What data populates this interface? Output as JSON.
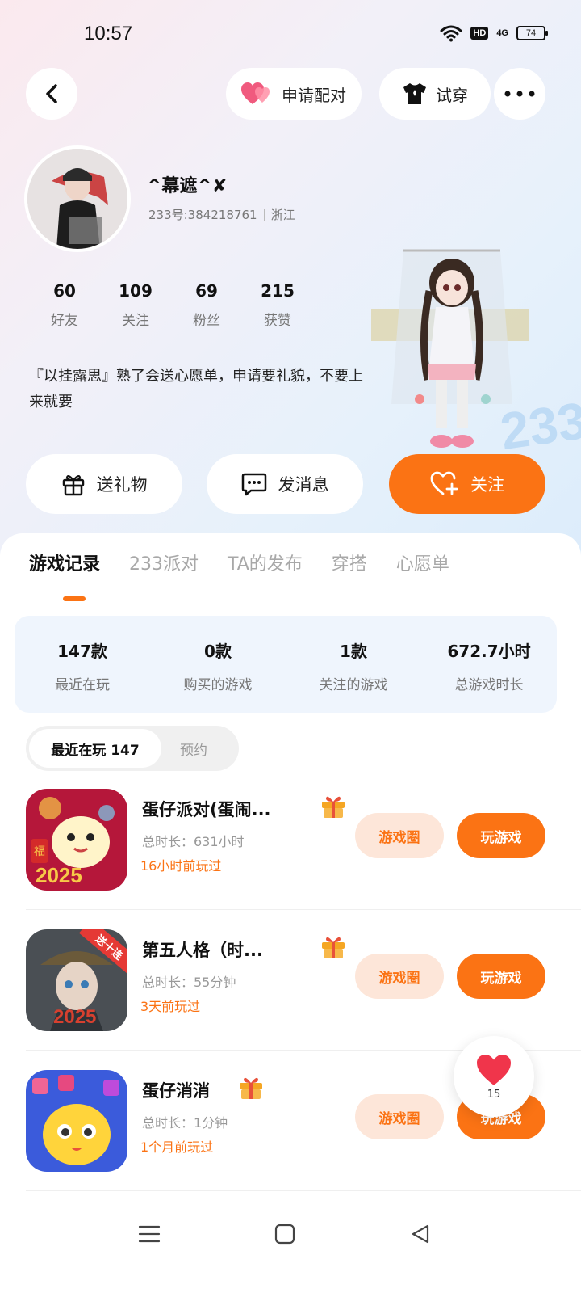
{
  "status_bar": {
    "time": "10:57",
    "hd": "HD",
    "network": "4G",
    "battery": "74"
  },
  "header": {
    "pair_label": "申请配对",
    "try_label": "试穿"
  },
  "profile": {
    "username": "^幕遮^✘",
    "id_text": "233号:384218761",
    "region": "浙江",
    "stats": [
      {
        "num": "60",
        "label": "好友"
      },
      {
        "num": "109",
        "label": "关注"
      },
      {
        "num": "69",
        "label": "粉丝"
      },
      {
        "num": "215",
        "label": "获赞"
      }
    ],
    "bio": "『以挂露思』熟了会送心愿单，申请要礼貌，不要上来就要"
  },
  "actions": {
    "gift": "送礼物",
    "message": "发消息",
    "follow": "关注"
  },
  "tabs": [
    "游戏记录",
    "233派对",
    "TA的发布",
    "穿搭",
    "心愿单"
  ],
  "active_tab": "游戏记录",
  "summary": [
    {
      "num": "147款",
      "label": "最近在玩"
    },
    {
      "num": "0款",
      "label": "购买的游戏"
    },
    {
      "num": "1款",
      "label": "关注的游戏"
    },
    {
      "num": "672.7小时",
      "label": "总游戏时长"
    }
  ],
  "segment": {
    "active": "最近在玩 147",
    "inactive": "预约"
  },
  "games": [
    {
      "name": "蛋仔派对(蛋闹...",
      "duration": "总时长：631小时",
      "last": "16小时前玩过",
      "circle_label": "游戏圈",
      "play_label": "玩游戏",
      "icon": "eggy-party-icon",
      "corner_badge": ""
    },
    {
      "name": "第五人格（时...",
      "duration": "总时长：55分钟",
      "last": "3天前玩过",
      "circle_label": "游戏圈",
      "play_label": "玩游戏",
      "icon": "identity-v-icon",
      "corner_badge": "送十连"
    },
    {
      "name": "蛋仔消消",
      "duration": "总时长：1分钟",
      "last": "1个月前玩过",
      "circle_label": "游戏圈",
      "play_label": "玩游戏",
      "icon": "eggy-match-icon",
      "corner_badge": ""
    }
  ],
  "game_icon_text": {
    "year": "2025",
    "fu": "福"
  },
  "like_float": {
    "count": "15"
  },
  "colors": {
    "accent": "#fb7314",
    "accent_light": "#fde6d9",
    "summary_bg": "#eff5fd"
  }
}
